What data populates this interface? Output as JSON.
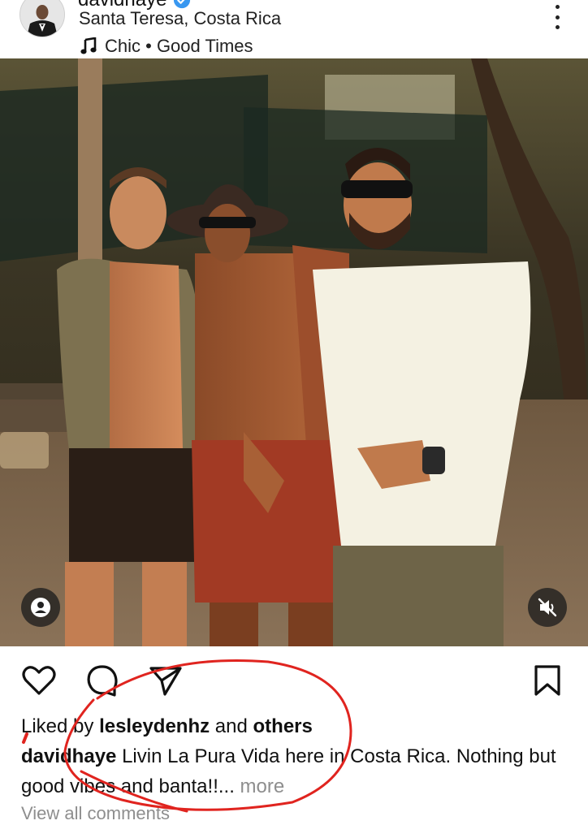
{
  "post": {
    "username": "davidhaye",
    "location": "Santa Teresa, Costa Rica",
    "music": "Chic • Good Times"
  },
  "likes": {
    "prefix": "Liked by",
    "user": "lesleydenhz",
    "middle": "and",
    "suffix": "others"
  },
  "caption": {
    "username": "davidhaye",
    "text": "Livin La Pura Vida here in Costa Rica. Nothing but good vibes and banta!!",
    "ellipsis": "...",
    "more": "more"
  },
  "comments": {
    "view_label": "View all comments"
  },
  "icons": {
    "more": "more-vertical-icon",
    "music": "music-note-icon",
    "tag": "person-tag-icon",
    "mute": "speaker-muted-icon",
    "like": "heart-icon",
    "comment": "comment-bubble-icon",
    "share": "paper-plane-icon",
    "save": "bookmark-icon",
    "verified": "verified-badge-icon"
  },
  "colors": {
    "verified": "#3897f0",
    "annotation": "#e0241f",
    "muted_text": "#8e8e8e"
  }
}
